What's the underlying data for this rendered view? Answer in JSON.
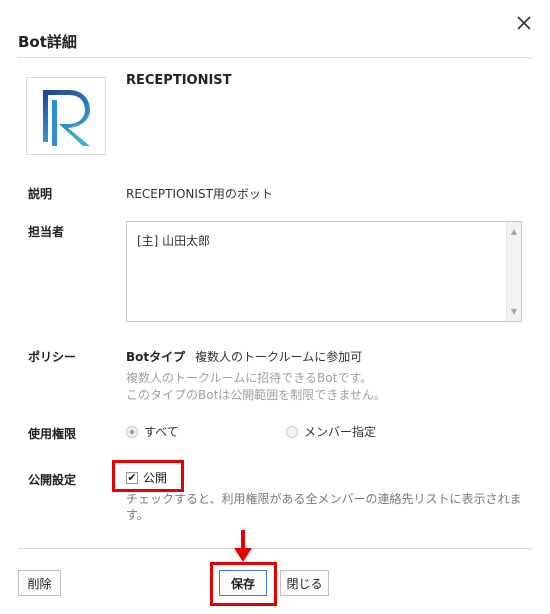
{
  "dialog": {
    "title": "Bot詳細"
  },
  "bot": {
    "name": "RECEPTIONIST"
  },
  "fields": {
    "description_label": "説明",
    "description_value": "RECEPTIONIST用のボット",
    "owner_label": "担当者",
    "owner_value": "[主] 山田太郎",
    "policy_label": "ポリシー",
    "policy_type_label": "Botタイプ",
    "policy_type_value": "複数人のトークルームに参加可",
    "policy_note_1": "複数人のトークルームに招待できるBotです。",
    "policy_note_2": "このタイプのBotは公開範囲を制限できません。",
    "usage_label": "使用権限",
    "usage_option_all": "すべて",
    "usage_option_members": "メンバー指定",
    "usage_selected": "すべて",
    "public_label": "公開設定",
    "public_checkbox_label": "公開",
    "public_checked": true,
    "public_help": "チェックすると、利用権限がある全メンバーの連絡先リストに表示されます。"
  },
  "footer": {
    "delete_label": "削除",
    "save_label": "保存",
    "close_label": "閉じる"
  },
  "colors": {
    "highlight": "#e60000",
    "save_border": "#3a7bd5",
    "logo_gradient_top": "#1f3f9a",
    "logo_gradient_bottom": "#3ab0d8"
  }
}
